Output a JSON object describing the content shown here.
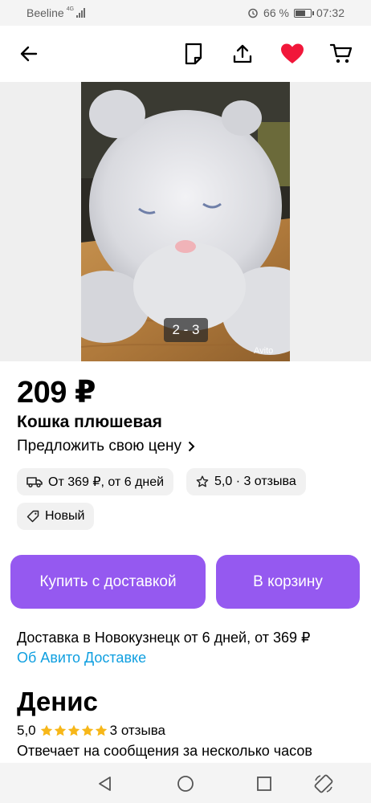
{
  "status_bar": {
    "carrier": "Beeline",
    "network": "4G",
    "battery": "66 %",
    "time": "07:32"
  },
  "toolbar": {
    "icons": [
      "back-arrow-icon",
      "note-icon",
      "share-icon",
      "favorite-heart-icon",
      "cart-icon"
    ],
    "accent_color": "#f1173a"
  },
  "gallery": {
    "counter": "2 - 3",
    "watermark": "Avito"
  },
  "listing": {
    "price": "209 ₽",
    "title": "Кошка плюшевая",
    "offer_label": "Предложить свою цену"
  },
  "chips": {
    "delivery": "От 369 ₽, от 6 дней",
    "rating": "5,0 · 3 отзыва",
    "condition": "Новый"
  },
  "actions": {
    "buy_label": "Купить с доставкой",
    "cart_label": "В корзину",
    "color": "#9559f0"
  },
  "delivery": {
    "text": "Доставка в Новокузнецк от 6 дней, от 369 ₽",
    "link": "Об Авито Доставке",
    "link_color": "#0f9fe0"
  },
  "seller": {
    "name": "Денис",
    "rating": "5,0",
    "stars": 5,
    "reviews": "3 отзыва",
    "response": "Отвечает на сообщения за несколько часов",
    "star_color": "#f7b719"
  },
  "nav_bar": {
    "icons": [
      "back-triangle-icon",
      "home-circle-icon",
      "recents-square-icon",
      "rotate-icon"
    ]
  }
}
